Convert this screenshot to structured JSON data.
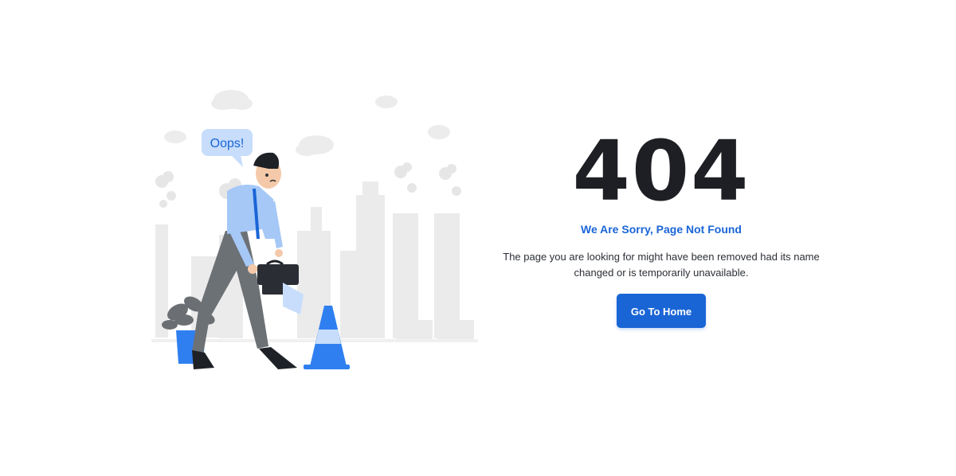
{
  "illustration": {
    "bubble_text": "Oops!"
  },
  "error": {
    "code": "404",
    "title": "We Are Sorry, Page Not Found",
    "description": "The page you are looking for might have been removed had its name changed or is temporarily unavailable."
  },
  "actions": {
    "home_label": "Go To Home"
  },
  "colors": {
    "accent": "#1a65d6",
    "heading": "#1e1f24",
    "text": "#2b2f36"
  }
}
